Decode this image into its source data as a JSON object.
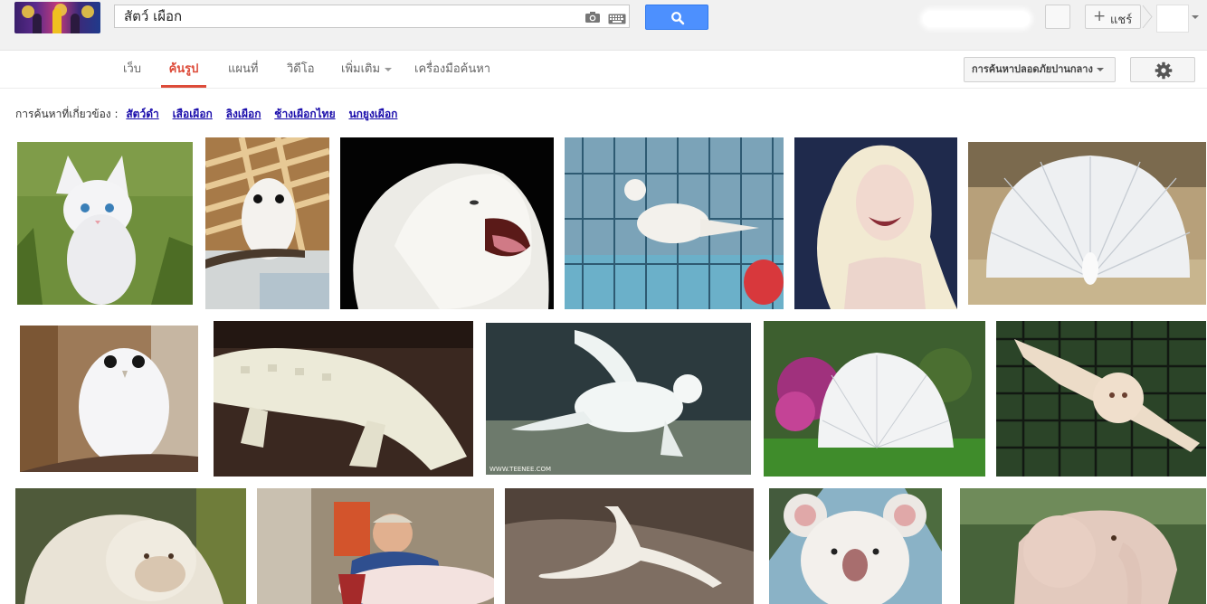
{
  "search": {
    "query": "สัตว์ เผือก"
  },
  "header": {
    "share_label": "แชร์",
    "share_plus": "+"
  },
  "nav": {
    "tabs": [
      {
        "label": "เว็บ"
      },
      {
        "label": "ค้นรูป",
        "active": true
      },
      {
        "label": "แผนที่"
      },
      {
        "label": "วิดีโอ"
      },
      {
        "label": "เพิ่มเติม",
        "dropdown": true
      },
      {
        "label": "เครื่องมือค้นหา"
      }
    ],
    "safesearch_label": "การค้นหาปลอดภัยปานกลาง"
  },
  "related": {
    "prefix": "การค้นหาที่เกี่ยวข้อง :",
    "links": [
      "สัตว์ดำ",
      "เสือเผือก",
      "ลิงเผือก",
      "ช้างเผือกไทย",
      "นกยูงเผือก"
    ]
  },
  "results": {
    "images": [
      {
        "subject": "white-kitten"
      },
      {
        "subject": "white-owl-perched"
      },
      {
        "subject": "white-lion-roaring"
      },
      {
        "subject": "white-bird-in-cage"
      },
      {
        "subject": "albino-woman"
      },
      {
        "subject": "white-peacock-display"
      },
      {
        "subject": "white-owl-closeup"
      },
      {
        "subject": "albino-alligator"
      },
      {
        "subject": "albino-sea-turtle",
        "watermark": "WWW.TEENEE.COM"
      },
      {
        "subject": "white-peacock-garden"
      },
      {
        "subject": "albino-monkey-climbing"
      },
      {
        "subject": "albino-gorilla"
      },
      {
        "subject": "man-holding-albino-fish"
      },
      {
        "subject": "albino-alligator-on-rock"
      },
      {
        "subject": "white-koala"
      },
      {
        "subject": "white-elephant"
      }
    ]
  },
  "colors": {
    "accent_red": "#dd4b39",
    "link_blue": "#1a0dab",
    "search_blue": "#4d90fe"
  }
}
